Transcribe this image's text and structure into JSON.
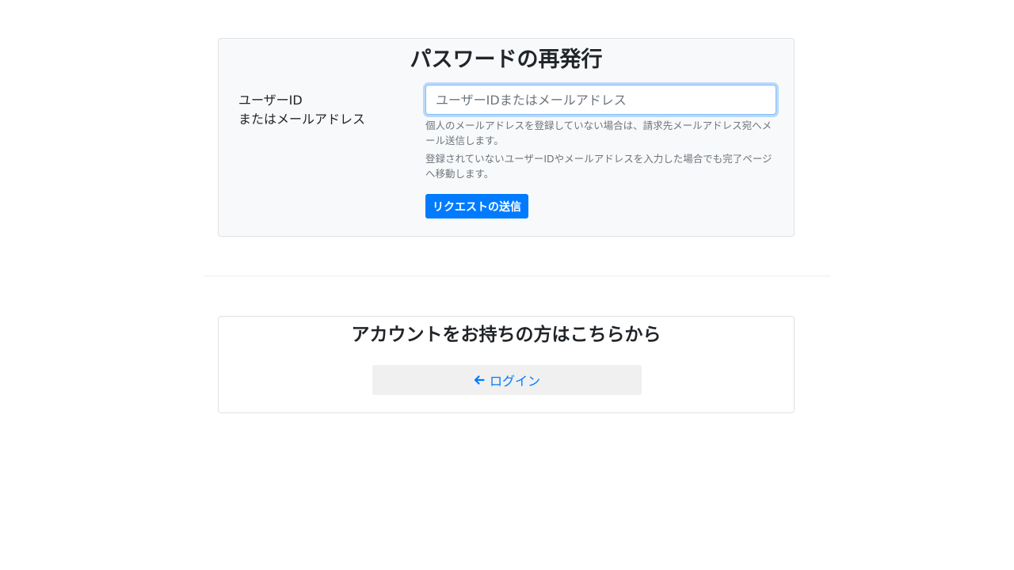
{
  "reset": {
    "title": "パスワードの再発行",
    "label_line1": "ユーザーID",
    "label_line2": "またはメールアドレス",
    "input_value": "",
    "input_placeholder": "ユーザーIDまたはメールアドレス",
    "help_1": "個人のメールアドレスを登録していない場合は、請求先メールアドレス宛へメール送信します。",
    "help_2": "登録されていないユーザーIDやメールアドレスを入力した場合でも完了ページへ移動します。",
    "submit_label": "リクエストの送信"
  },
  "login": {
    "title": "アカウントをお持ちの方はこちらから",
    "button_label": "ログイン",
    "button_icon": "arrow-left-icon"
  },
  "colors": {
    "primary": "#007bff",
    "card_background": "#f8f9fa",
    "muted_text": "#6c757d"
  }
}
